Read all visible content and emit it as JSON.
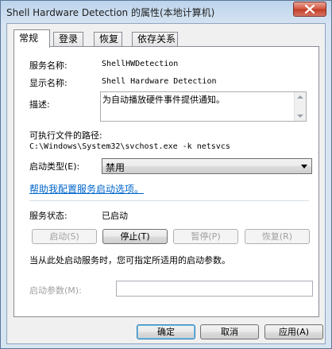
{
  "window": {
    "title": "Shell Hardware Detection 的属性(本地计算机)"
  },
  "tabs": [
    {
      "label": "常规"
    },
    {
      "label": "登录"
    },
    {
      "label": "恢复"
    },
    {
      "label": "依存关系"
    }
  ],
  "general": {
    "service_name_label": "服务名称:",
    "service_name_value": "ShellHWDetection",
    "display_name_label": "显示名称:",
    "display_name_value": "Shell Hardware Detection",
    "description_label": "描述:",
    "description_value": "为自动播放硬件事件提供通知。",
    "exe_path_label": "可执行文件的路径:",
    "exe_path_value": "C:\\Windows\\System32\\svchost.exe -k netsvcs",
    "startup_type_label": "启动类型(E):",
    "startup_type_value": "禁用",
    "help_link": "帮助我配置服务启动选项。",
    "service_status_label": "服务状态:",
    "service_status_value": "已启动",
    "start_button": "启动(S)",
    "stop_button": "停止(T)",
    "pause_button": "暂停(P)",
    "resume_button": "恢复(R)",
    "hint_text": "当从此处启动服务时，您可指定所适用的启动参数。",
    "start_params_label": "启动参数(M):",
    "start_params_value": ""
  },
  "footer": {
    "ok_button": "确定",
    "cancel_button": "取消",
    "apply_button": "应用(A)"
  }
}
